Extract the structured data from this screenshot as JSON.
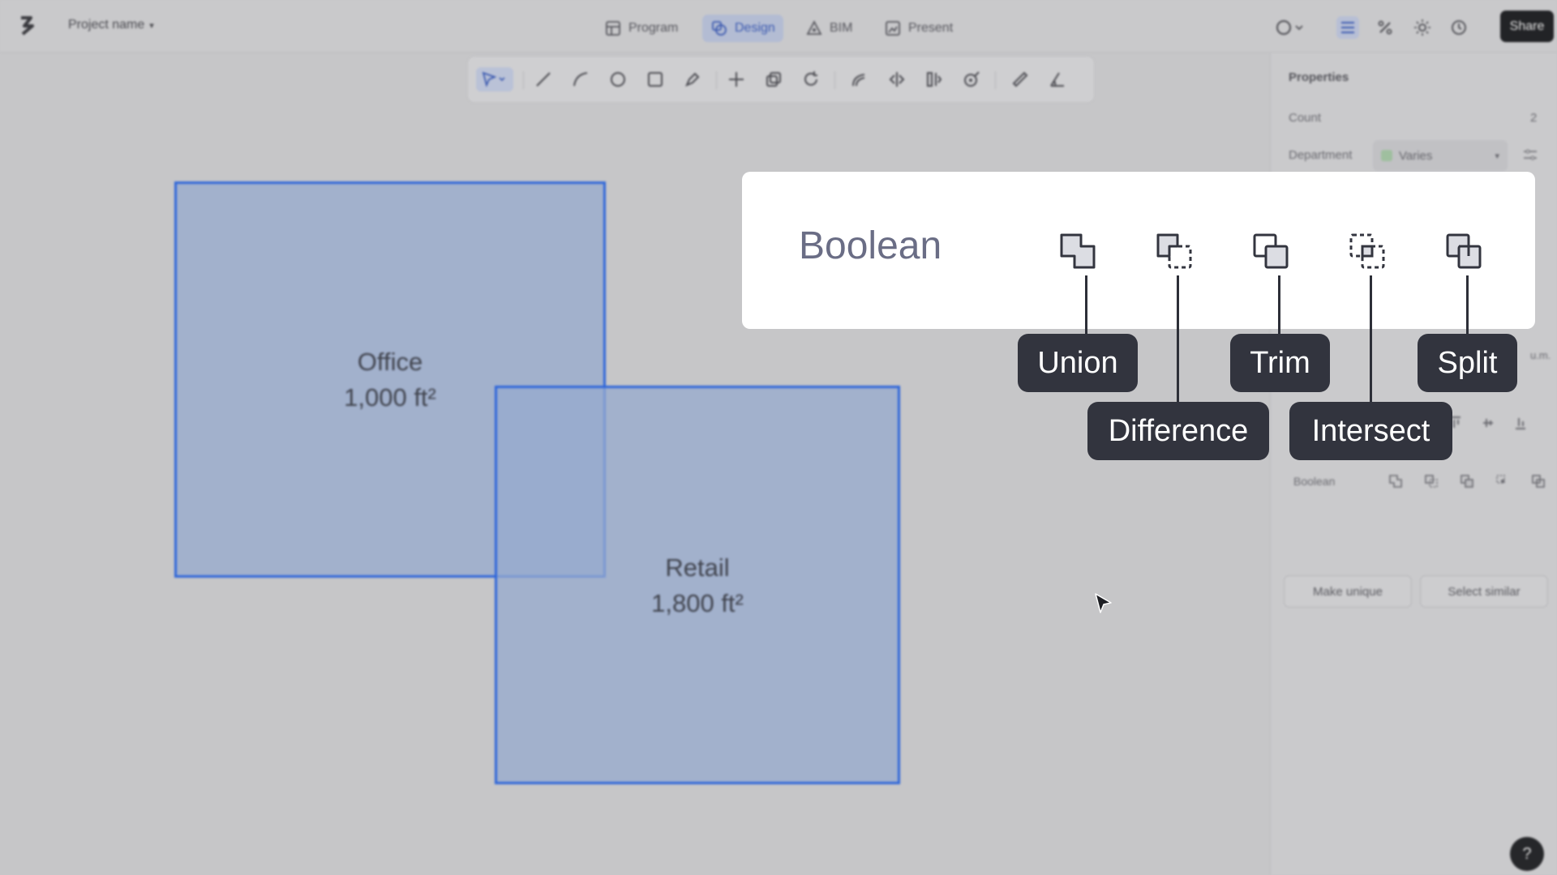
{
  "topbar": {
    "project_name": "Project name",
    "tabs": [
      {
        "label": "Program",
        "icon": "table-icon"
      },
      {
        "label": "Design",
        "icon": "shapes-icon",
        "active": true
      },
      {
        "label": "BIM",
        "icon": "bim-icon"
      },
      {
        "label": "Present",
        "icon": "present-icon"
      }
    ],
    "share_label": "Share"
  },
  "canvas": {
    "shapes": [
      {
        "name": "Office",
        "area": "1,000 ft²"
      },
      {
        "name": "Retail",
        "area": "1,800 ft²"
      }
    ]
  },
  "properties": {
    "title": "Properties",
    "count_label": "Count",
    "count_value": "2",
    "department_label": "Department",
    "department_value": "Varies",
    "boolean_label": "Boolean",
    "make_unique": "Make unique",
    "select_similar": "Select similar",
    "help": "?",
    "partial_unit": "u.m."
  },
  "callout": {
    "title": "Boolean",
    "operations": [
      "Union",
      "Difference",
      "Trim",
      "Intersect",
      "Split"
    ]
  },
  "colors": {
    "accent": "#2f66d9",
    "shape_fill": "#a0afcb",
    "pill": "#32343e"
  }
}
